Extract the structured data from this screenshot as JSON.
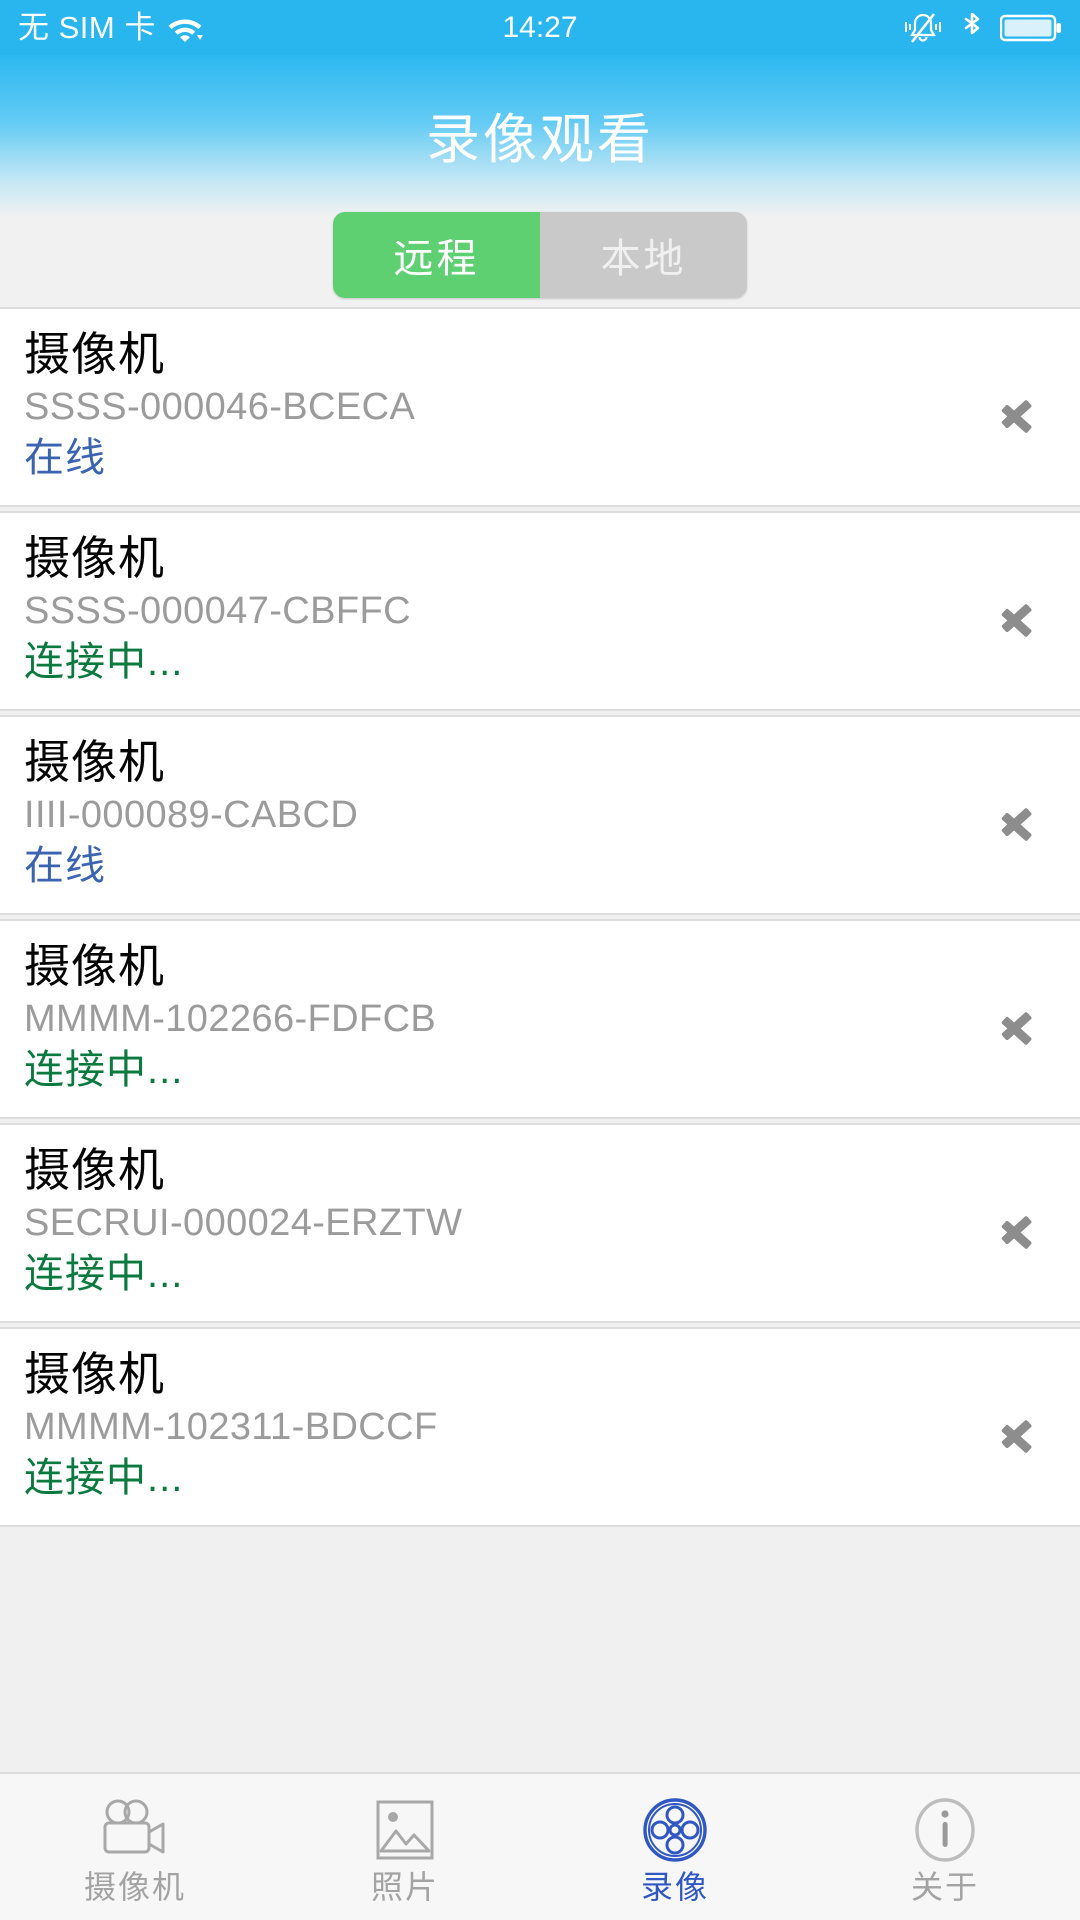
{
  "status_bar": {
    "carrier": "无 SIM 卡",
    "clock": "14:27",
    "icons": [
      "wifi-icon",
      "vibrate-mute-icon",
      "bluetooth-icon",
      "battery-full-icon"
    ]
  },
  "header": {
    "title": "录像观看"
  },
  "segmented_control": {
    "options": [
      {
        "label": "远程",
        "selected": true
      },
      {
        "label": "本地",
        "selected": false
      }
    ],
    "active_color": "#5ed072",
    "inactive_color": "#c9c9c9"
  },
  "camera_list": {
    "items": [
      {
        "name": "摄像机",
        "id": "SSSS-000046-BCECA",
        "status": "在线",
        "status_type": "online"
      },
      {
        "name": "摄像机",
        "id": "SSSS-000047-CBFFC",
        "status": "连接中...",
        "status_type": "connecting"
      },
      {
        "name": "摄像机",
        "id": "IIII-000089-CABCD",
        "status": "在线",
        "status_type": "online"
      },
      {
        "name": "摄像机",
        "id": "MMMM-102266-FDFCB",
        "status": "连接中...",
        "status_type": "connecting"
      },
      {
        "name": "摄像机",
        "id": "SECRUI-000024-ERZTW",
        "status": "连接中...",
        "status_type": "connecting"
      },
      {
        "name": "摄像机",
        "id": "MMMM-102311-BDCCF",
        "status": "连接中...",
        "status_type": "connecting"
      }
    ],
    "status_colors": {
      "online": "#3a63b0",
      "connecting": "#0a7a3e"
    },
    "disclosure_icon": "chevron-right-icon"
  },
  "tab_bar": {
    "tabs": [
      {
        "label": "摄像机",
        "icon": "camcorder-icon",
        "active": false
      },
      {
        "label": "照片",
        "icon": "photo-icon",
        "active": false
      },
      {
        "label": "录像",
        "icon": "film-reel-icon",
        "active": true
      },
      {
        "label": "关于",
        "icon": "info-icon",
        "active": false
      }
    ],
    "active_color": "#2f58c4",
    "inactive_color": "#a3a3a3"
  }
}
